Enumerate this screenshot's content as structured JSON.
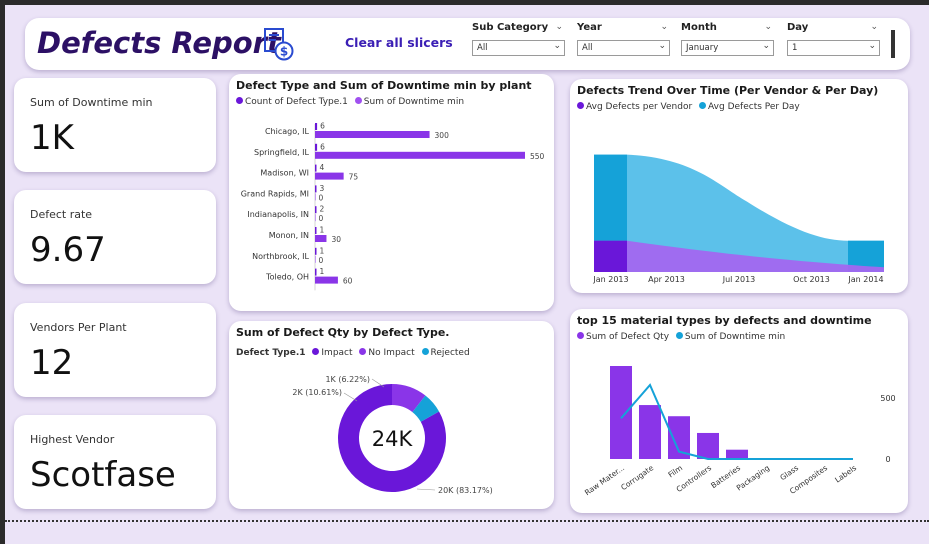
{
  "header": {
    "title": "Defects Report",
    "clear_label": "Clear all slicers",
    "slicers": [
      {
        "label": "Sub Category",
        "value": "All"
      },
      {
        "label": "Year",
        "value": "All"
      },
      {
        "label": "Month",
        "value": "January"
      },
      {
        "label": "Day",
        "value": "1"
      }
    ]
  },
  "kpis": [
    {
      "label": "Sum of Downtime min",
      "value": "1K"
    },
    {
      "label": "Defect rate",
      "value": "9.67"
    },
    {
      "label": "Vendors Per Plant",
      "value": "12"
    },
    {
      "label": "Highest Vendor",
      "value": "Scotfase"
    }
  ],
  "colors": {
    "dark_purple": "#6a17d9",
    "purple": "#8a35e8",
    "light_purple": "#a267f0",
    "cyan": "#15a2d8",
    "light_cyan": "#5cc1ea"
  },
  "chart_data": [
    {
      "type": "bar",
      "title": "Defect Type and Sum of Downtime min by plant",
      "legend": [
        "Count of Defect Type.1",
        "Sum of Downtime min"
      ],
      "categories": [
        "Chicago, IL",
        "Springfield, IL",
        "Madison, WI",
        "Grand Rapids, MI",
        "Indianapolis, IN",
        "Monon, IN",
        "Northbrook, IL",
        "Toledo, OH"
      ],
      "series": [
        {
          "name": "Count of Defect Type.1",
          "values": [
            6,
            6,
            4,
            3,
            2,
            1,
            1,
            1
          ]
        },
        {
          "name": "Sum of Downtime min",
          "values": [
            300,
            550,
            75,
            0,
            0,
            30,
            0,
            60
          ]
        }
      ]
    },
    {
      "type": "area",
      "title": "Defects Trend Over Time (Per Vendor & Per Day)",
      "legend": [
        "Avg Defects per Vendor",
        "Avg Defects Per Day"
      ],
      "x": [
        "Jan 2013",
        "Apr 2013",
        "Jul 2013",
        "Oct 2013",
        "Jan 2014"
      ],
      "series": [
        {
          "name": "Avg Defects per Vendor",
          "values": [
            1.0,
            0.9,
            0.5,
            0.3,
            0.3
          ]
        },
        {
          "name": "Avg Defects Per Day",
          "values": [
            7.5,
            7.3,
            4.5,
            2.3,
            2.0
          ]
        }
      ]
    },
    {
      "type": "pie",
      "title": "Sum of Defect Qty by Defect Type.",
      "legend_title": "Defect Type.1",
      "legend": [
        "Impact",
        "No Impact",
        "Rejected"
      ],
      "center_label": "24K",
      "slices": [
        {
          "name": "Impact",
          "value": 83.17,
          "label": "20K (83.17%)"
        },
        {
          "name": "No Impact",
          "value": 10.61,
          "label": "2K (10.61%)"
        },
        {
          "name": "Rejected",
          "value": 6.22,
          "label": "1K (6.22%)"
        }
      ]
    },
    {
      "type": "bar",
      "title": "top 15 material types by defects and downtime",
      "legend": [
        "Sum of Defect Qty",
        "Sum of Downtime min"
      ],
      "categories": [
        "Raw Mater...",
        "Corrugate",
        "Film",
        "Controllers",
        "Batteries",
        "Packaging",
        "Glass",
        "Composites",
        "Labels"
      ],
      "y2_ticks": [
        "500",
        "0"
      ],
      "series": [
        {
          "name": "Sum of Defect Qty",
          "values": [
            100,
            58,
            46,
            28,
            10,
            1,
            1,
            1,
            0
          ]
        },
        {
          "name": "Sum of Downtime min",
          "values": [
            330,
            600,
            60,
            0,
            0,
            0,
            0,
            0,
            0
          ]
        }
      ]
    }
  ]
}
